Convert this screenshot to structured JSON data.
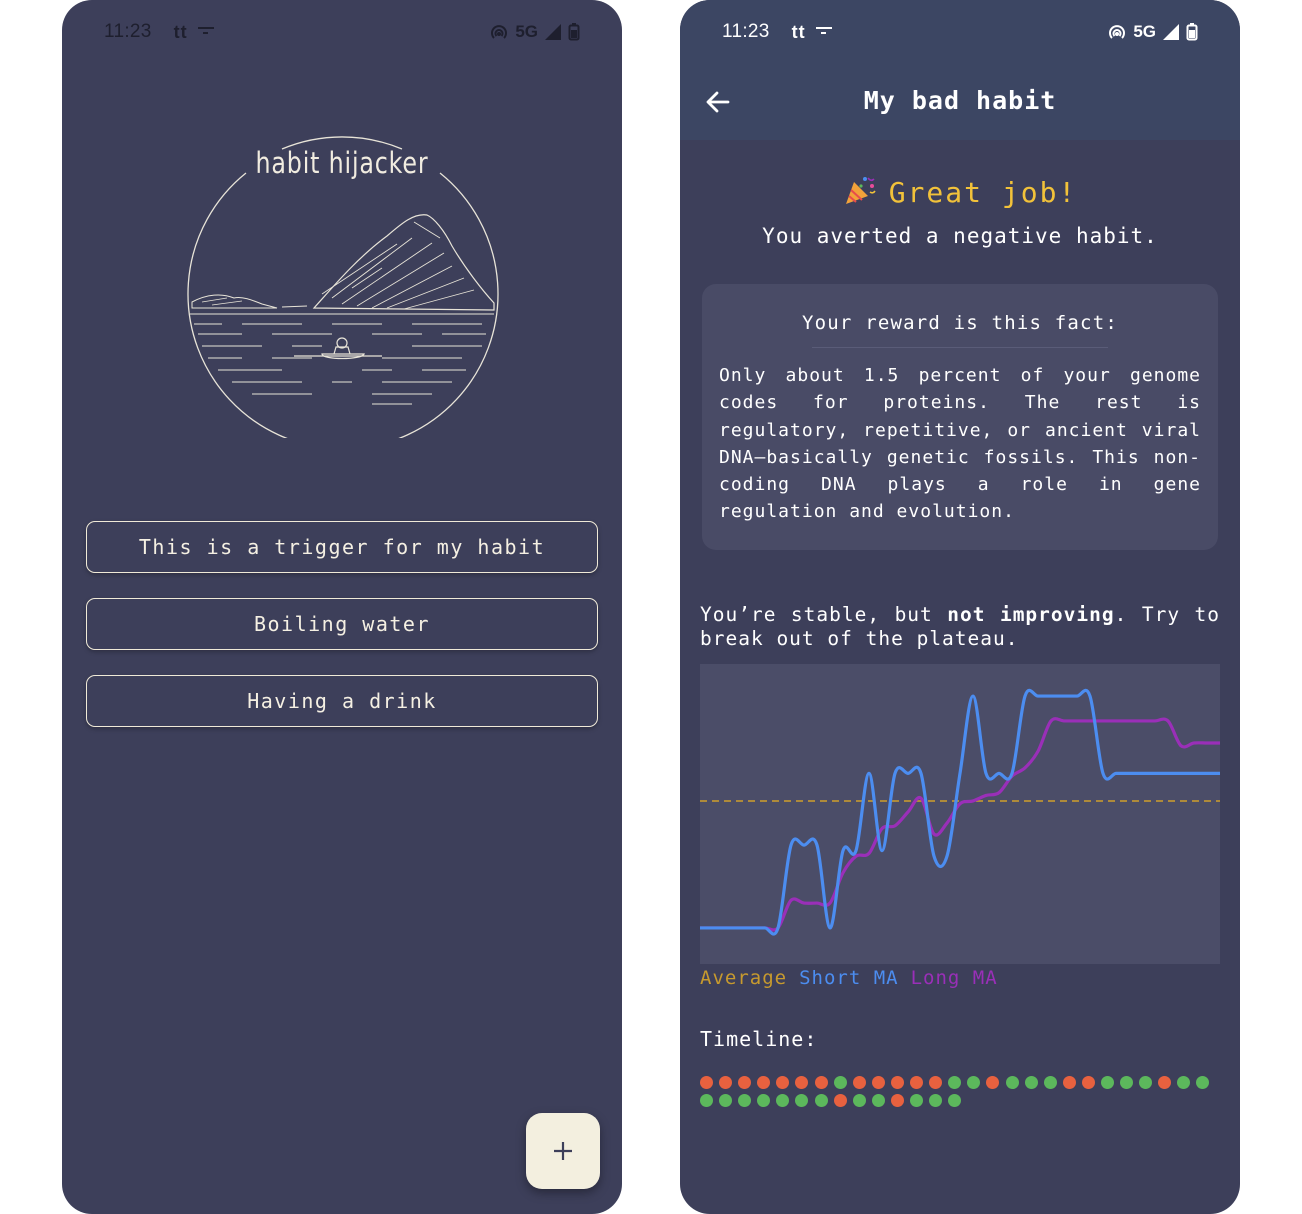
{
  "status_bar": {
    "time": "11:23",
    "carrier_icon_text": "tt",
    "network": "5G"
  },
  "home": {
    "logo_title": "habit hijacker",
    "triggers": [
      {
        "label": "This is a trigger for my habit"
      },
      {
        "label": "Boiling water"
      },
      {
        "label": "Having a drink"
      }
    ],
    "fab_icon": "plus-icon"
  },
  "detail": {
    "title": "My bad habit",
    "back_icon": "arrow-left-icon",
    "celebration_icon": "party-popper-icon",
    "headline": "Great job!",
    "subheadline": "You averted a negative habit.",
    "reward": {
      "title": "Your reward is this fact:",
      "text": "Only about 1.5 percent of your genome codes for proteins. The rest is regulatory, repetitive, or ancient viral DNA—basically genetic fossils. This non-coding DNA plays a role in gene regulation and evolution."
    },
    "status_message": {
      "before": "You’re stable, but ",
      "emphasis": "not improving",
      "after": ". Try to break out of the plateau."
    },
    "legend": [
      {
        "label": "Average",
        "color": "#c79a2e"
      },
      {
        "label": "Short MA",
        "color": "#4c8df0"
      },
      {
        "label": "Long MA",
        "color": "#9a2fb8"
      }
    ],
    "timeline_label": "Timeline:",
    "timeline": [
      "averted-no",
      "averted-no",
      "averted-no",
      "averted-no",
      "averted-no",
      "averted-no",
      "averted-no",
      "averted-yes",
      "averted-no",
      "averted-no",
      "averted-no",
      "averted-no",
      "averted-no",
      "averted-yes",
      "averted-yes",
      "averted-no",
      "averted-yes",
      "averted-yes",
      "averted-yes",
      "averted-no",
      "averted-no",
      "averted-yes",
      "averted-yes",
      "averted-yes",
      "averted-no",
      "averted-yes",
      "averted-yes",
      "averted-yes",
      "averted-yes",
      "averted-yes",
      "averted-yes",
      "averted-yes",
      "averted-yes",
      "averted-yes",
      "averted-no",
      "averted-yes",
      "averted-yes",
      "averted-no",
      "averted-yes",
      "averted-yes",
      "averted-yes"
    ],
    "timeline_colors": {
      "averted-yes": "#5cb85c",
      "averted-no": "#e8613f"
    }
  },
  "chart_data": {
    "type": "line",
    "ylim": [
      0,
      10
    ],
    "x": [
      0,
      1,
      2,
      3,
      4,
      5,
      6,
      7,
      8,
      9,
      10,
      11,
      12,
      13,
      14,
      15,
      16,
      17,
      18,
      19,
      20,
      21,
      22,
      23,
      24,
      25,
      26,
      27,
      28,
      29,
      30,
      31,
      32,
      33,
      34,
      35,
      36,
      37,
      38,
      39,
      40
    ],
    "series": [
      {
        "name": "Average",
        "style": "dashed",
        "color": "#c79a2e",
        "values": [
          5.4,
          5.4,
          5.4,
          5.4,
          5.4,
          5.4,
          5.4,
          5.4,
          5.4,
          5.4,
          5.4,
          5.4,
          5.4,
          5.4,
          5.4,
          5.4,
          5.4,
          5.4,
          5.4,
          5.4,
          5.4,
          5.4,
          5.4,
          5.4,
          5.4,
          5.4,
          5.4,
          5.4,
          5.4,
          5.4,
          5.4,
          5.4,
          5.4,
          5.4,
          5.4,
          5.4,
          5.4,
          5.4,
          5.4,
          5.4,
          5.4
        ]
      },
      {
        "name": "Short MA",
        "color": "#4c8df0",
        "values": [
          0.8,
          0.8,
          0.8,
          0.8,
          0.8,
          0.8,
          0.8,
          3.8,
          3.8,
          3.8,
          0.8,
          3.6,
          3.6,
          6.4,
          3.6,
          6.4,
          6.4,
          6.4,
          3.4,
          3.4,
          6.4,
          9.2,
          6.4,
          6.4,
          6.4,
          9.2,
          9.2,
          9.2,
          9.2,
          9.2,
          9.2,
          6.4,
          6.4,
          6.4,
          6.4,
          6.4,
          6.4,
          6.4,
          6.4,
          6.4,
          6.4
        ]
      },
      {
        "name": "Long MA",
        "color": "#9a2fb8",
        "values": [
          0.8,
          0.8,
          0.8,
          0.8,
          0.8,
          0.8,
          0.8,
          1.8,
          1.7,
          1.7,
          1.7,
          2.8,
          3.4,
          3.5,
          4.4,
          4.5,
          5.0,
          5.5,
          4.2,
          4.6,
          5.3,
          5.4,
          5.6,
          5.7,
          6.3,
          6.6,
          7.2,
          8.3,
          8.3,
          8.3,
          8.3,
          8.3,
          8.3,
          8.3,
          8.3,
          8.3,
          8.3,
          7.4,
          7.5,
          7.5,
          7.5
        ]
      }
    ],
    "grid": false,
    "legend_position": "bottom-left"
  }
}
